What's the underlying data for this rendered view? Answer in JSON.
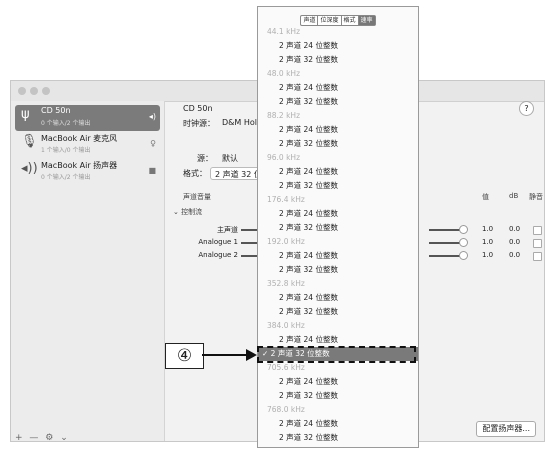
{
  "sidebar": {
    "devices": [
      {
        "name": "CD 50n",
        "sub": "0 个输入/2 个输出"
      },
      {
        "name": "MacBook Air 麦克风",
        "sub": "1 个输入/0 个输出"
      },
      {
        "name": "MacBook Air 扬声器",
        "sub": "0 个输入/2 个输出"
      }
    ],
    "footer": "+ — ⚙ ⌄"
  },
  "main": {
    "device_title": "CD 50n",
    "clock_source_label": "时钟源：",
    "clock_source_value": "D&M Hold",
    "source_label": "源：",
    "source_value": "默认",
    "format_label": "格式：",
    "format_value": "2 声道 32 位",
    "help": "?",
    "volume_header": "声道音量",
    "value_header": "值",
    "db_header": "dB",
    "mute_header": "静音",
    "master_stream": "控制流",
    "channels": [
      {
        "label": "主声道",
        "value": "1.0",
        "db": "0.0"
      },
      {
        "label": "Analogue 1",
        "value": "1.0",
        "db": "0.0"
      },
      {
        "label": "Analogue 2",
        "value": "1.0",
        "db": "0.0"
      }
    ],
    "configure_button": "配置扬声器..."
  },
  "menu": {
    "tabs": [
      "声道",
      "位深度",
      "格式",
      "速率"
    ],
    "items": [
      {
        "type": "freq",
        "label": "44.1 kHz"
      },
      {
        "type": "opt",
        "label": "2 声道 24 位整数"
      },
      {
        "type": "opt",
        "label": "2 声道 32 位整数"
      },
      {
        "type": "freq",
        "label": "48.0 kHz"
      },
      {
        "type": "opt",
        "label": "2 声道 24 位整数"
      },
      {
        "type": "opt",
        "label": "2 声道 32 位整数"
      },
      {
        "type": "freq",
        "label": "88.2 kHz"
      },
      {
        "type": "opt",
        "label": "2 声道 24 位整数"
      },
      {
        "type": "opt",
        "label": "2 声道 32 位整数"
      },
      {
        "type": "freq",
        "label": "96.0 kHz"
      },
      {
        "type": "opt",
        "label": "2 声道 24 位整数"
      },
      {
        "type": "opt",
        "label": "2 声道 32 位整数"
      },
      {
        "type": "freq",
        "label": "176.4 kHz"
      },
      {
        "type": "opt",
        "label": "2 声道 24 位整数"
      },
      {
        "type": "opt",
        "label": "2 声道 32 位整数"
      },
      {
        "type": "freq",
        "label": "192.0 kHz"
      },
      {
        "type": "opt",
        "label": "2 声道 24 位整数"
      },
      {
        "type": "opt",
        "label": "2 声道 32 位整数"
      },
      {
        "type": "freq",
        "label": "352.8 kHz"
      },
      {
        "type": "opt",
        "label": "2 声道 24 位整数"
      },
      {
        "type": "opt",
        "label": "2 声道 32 位整数"
      },
      {
        "type": "freq",
        "label": "384.0 kHz"
      },
      {
        "type": "opt",
        "label": "2 声道 24 位整数"
      },
      {
        "type": "selected",
        "label": "✓ 2 声道 32 位整数"
      },
      {
        "type": "freq",
        "label": "705.6 kHz"
      },
      {
        "type": "opt",
        "label": "2 声道 24 位整数"
      },
      {
        "type": "opt",
        "label": "2 声道 32 位整数"
      },
      {
        "type": "freq",
        "label": "768.0 kHz"
      },
      {
        "type": "opt",
        "label": "2 声道 24 位整数"
      },
      {
        "type": "opt",
        "label": "2 声道 32 位整数"
      }
    ]
  },
  "callout": {
    "number": "④"
  }
}
